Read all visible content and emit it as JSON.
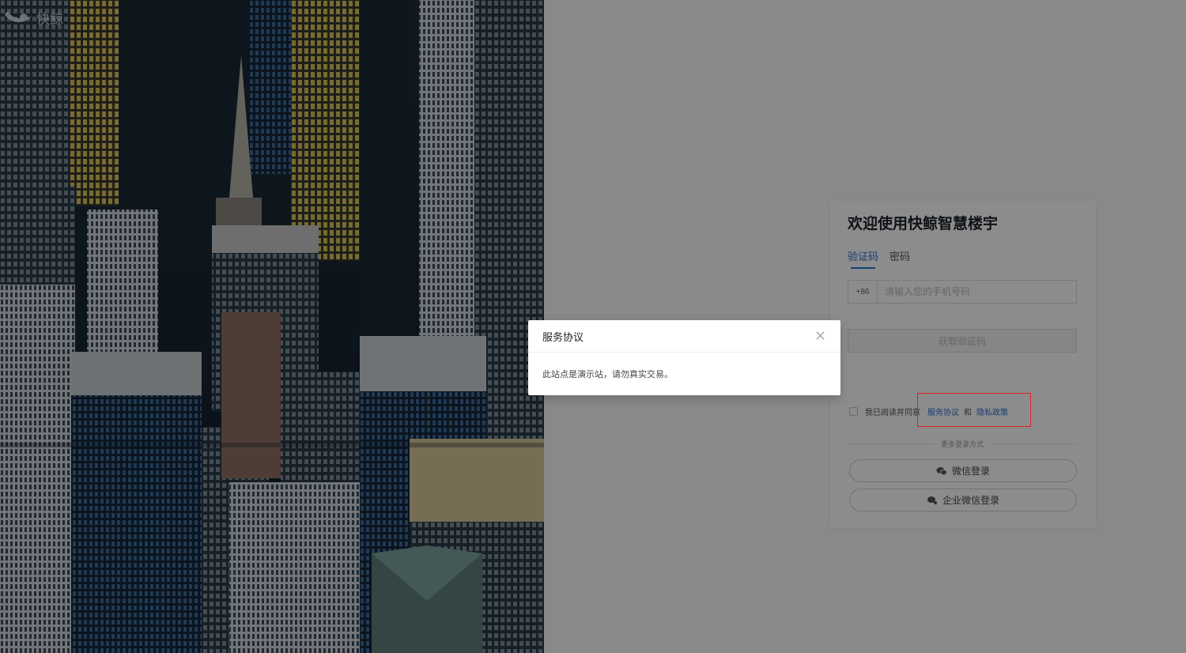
{
  "brand": {
    "name": "快鲸"
  },
  "login": {
    "title": "欢迎使用快鲸智慧楼宇",
    "tabs": [
      {
        "label": "验证码",
        "active": true
      },
      {
        "label": "密码",
        "active": false
      }
    ],
    "phone": {
      "prefix": "+86",
      "placeholder": "请输入您的手机号码",
      "value": ""
    },
    "get_code_label": "获取验证码",
    "agreement": {
      "checked": false,
      "text": "我已阅读并同意",
      "service_label": "服务协议",
      "and": "和",
      "privacy_label": "隐私政策"
    },
    "more_label": "更多登录方式",
    "wechat_label": "微信登录",
    "wework_label": "企业微信登录"
  },
  "modal": {
    "title": "服务协议",
    "body": "此站点是演示站，请勿真实交易。"
  },
  "colors": {
    "accent": "#2f6fd6",
    "highlight": "#e02020",
    "mask": "rgba(0,0,0,0.45)"
  }
}
